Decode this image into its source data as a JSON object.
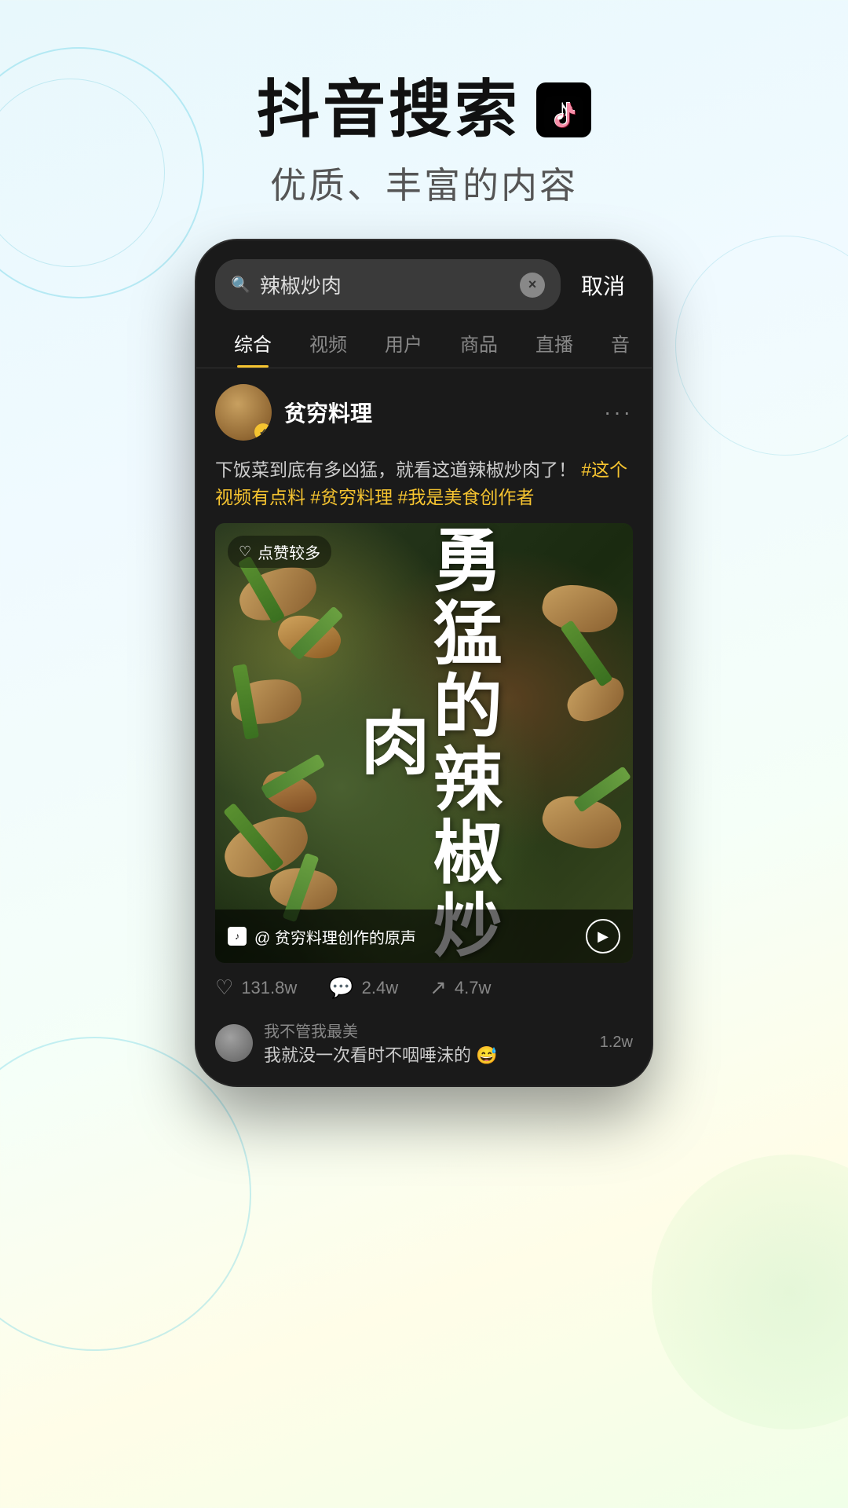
{
  "page": {
    "background_note": "gradient light blue-green-yellow"
  },
  "header": {
    "title": "抖音搜索",
    "tiktok_icon_label": "TikTok logo",
    "subtitle": "优质、丰富的内容"
  },
  "phone": {
    "search": {
      "query": "辣椒炒肉",
      "cancel_label": "取消",
      "clear_icon": "×",
      "search_icon": "🔍"
    },
    "tabs": [
      {
        "label": "综合",
        "active": true
      },
      {
        "label": "视频",
        "active": false
      },
      {
        "label": "用户",
        "active": false
      },
      {
        "label": "商品",
        "active": false
      },
      {
        "label": "直播",
        "active": false
      },
      {
        "label": "音",
        "active": false
      }
    ],
    "post": {
      "user": {
        "name": "贫穷料理",
        "verified": true
      },
      "description": "下饭菜到底有多凶猛，就看这道辣椒炒肉了！",
      "tags": "#这个视频有点料 #贫穷料理 #我是美食创作者",
      "likes_badge": "点赞较多",
      "video_text": "勇\n猛\n的\n辣\n椒\n炒\n肉",
      "audio_label": "@ 贫穷料理创作的原声",
      "stats": {
        "likes": "131.8w",
        "comments": "2.4w",
        "shares": "4.7w"
      }
    },
    "comments": [
      {
        "username": "我不管我最美",
        "text": "我就没一次看时不咽唾沫的 😅",
        "likes": "1.2w"
      }
    ]
  }
}
